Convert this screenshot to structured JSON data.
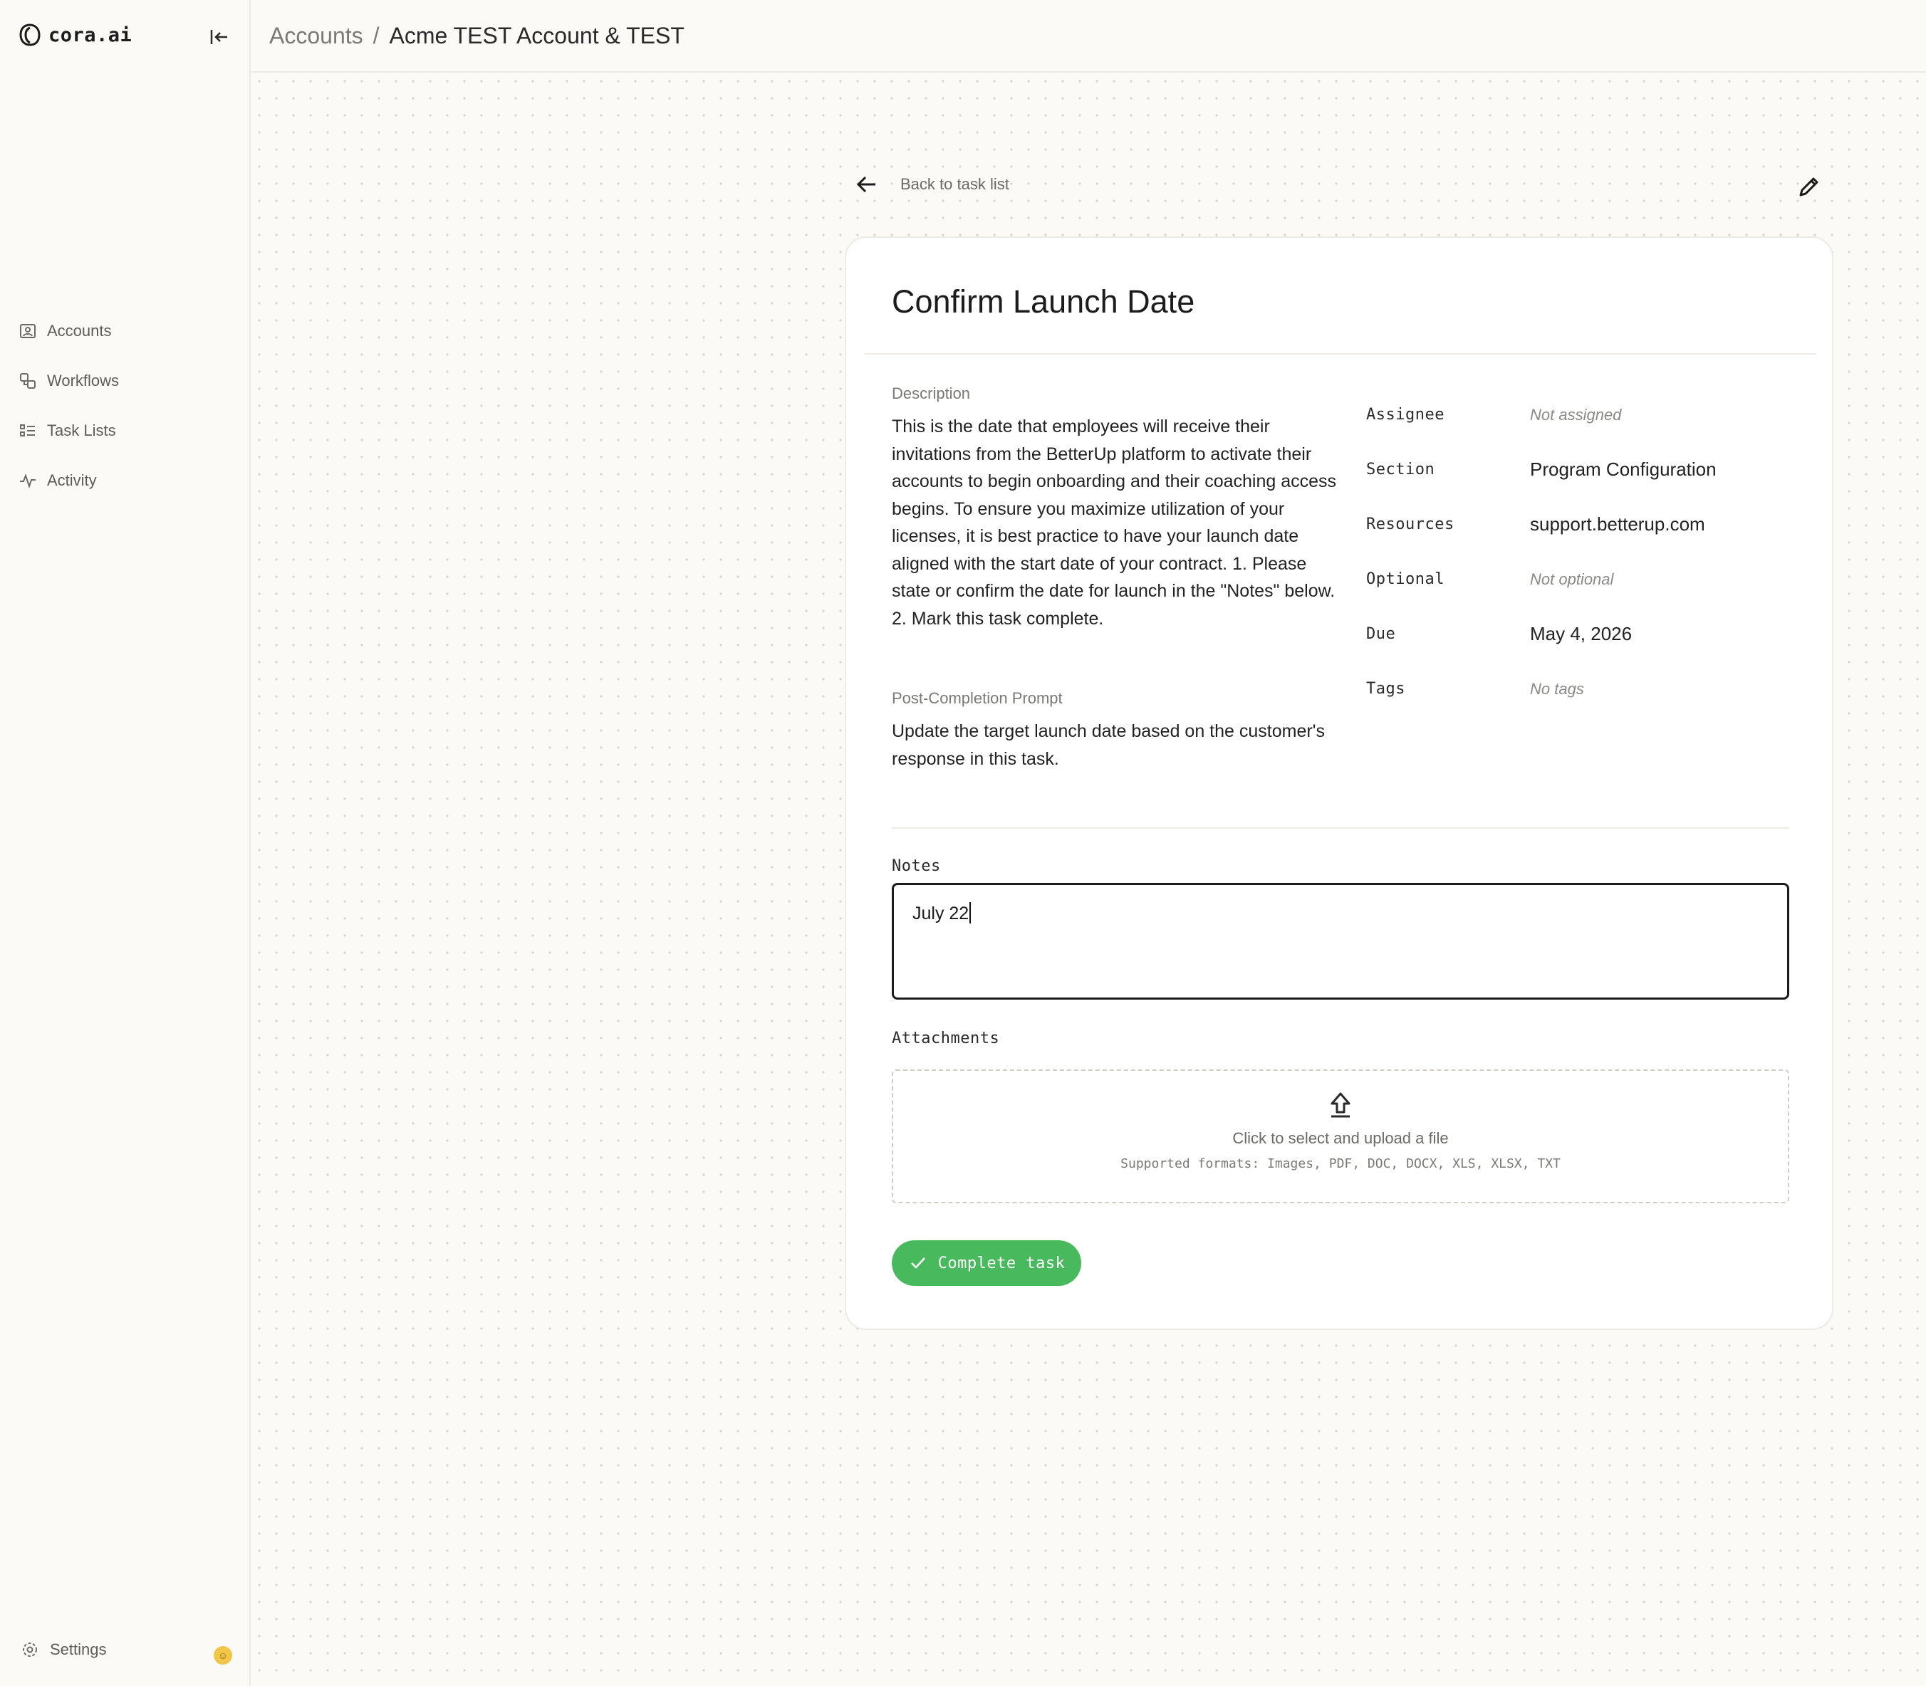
{
  "app": {
    "logo_text": "cora.ai"
  },
  "sidebar": {
    "items": [
      {
        "label": "Accounts",
        "icon": "accounts-icon"
      },
      {
        "label": "Workflows",
        "icon": "workflows-icon"
      },
      {
        "label": "Task Lists",
        "icon": "task-list-icon"
      },
      {
        "label": "Activity",
        "icon": "activity-icon"
      }
    ],
    "settings_label": "Settings",
    "settings_badge_icon": "smiley-badge-icon"
  },
  "header": {
    "breadcrumb_root": "Accounts",
    "breadcrumb_separator": "/",
    "breadcrumb_current": "Acme TEST Account & TEST"
  },
  "nav": {
    "back_label": "Back to task list"
  },
  "task": {
    "title": "Confirm Launch Date",
    "description_label": "Description",
    "description": "This is the date that employees will receive their invitations from the BetterUp platform to activate their accounts to begin onboarding and their coaching access begins. To ensure you maximize utilization of your licenses, it is best practice to have your launch date aligned with the start date of your contract. 1. Please state or confirm the date for launch in the \"Notes\" below. 2. Mark this task complete.",
    "post_completion_label": "Post-Completion Prompt",
    "post_completion": "Update the target launch date based on the customer's response in this task.",
    "meta": {
      "assignee_key": "Assignee",
      "assignee_val": "Not assigned",
      "section_key": "Section",
      "section_val": "Program Configuration",
      "resources_key": "Resources",
      "resources_val": "support.betterup.com",
      "optional_key": "Optional",
      "optional_val": "Not optional",
      "due_key": "Due",
      "due_val": "May 4, 2026",
      "tags_key": "Tags",
      "tags_val": "No tags"
    },
    "notes_label": "Notes",
    "notes_value": "July 22",
    "attachments_label": "Attachments",
    "upload_main": "Click to select and upload a file",
    "upload_formats": "Supported formats: Images, PDF, DOC, DOCX, XLS, XLSX, TXT",
    "complete_label": "Complete task"
  },
  "colors": {
    "accent_green": "#48b95c",
    "badge_yellow": "#f3c64a"
  }
}
